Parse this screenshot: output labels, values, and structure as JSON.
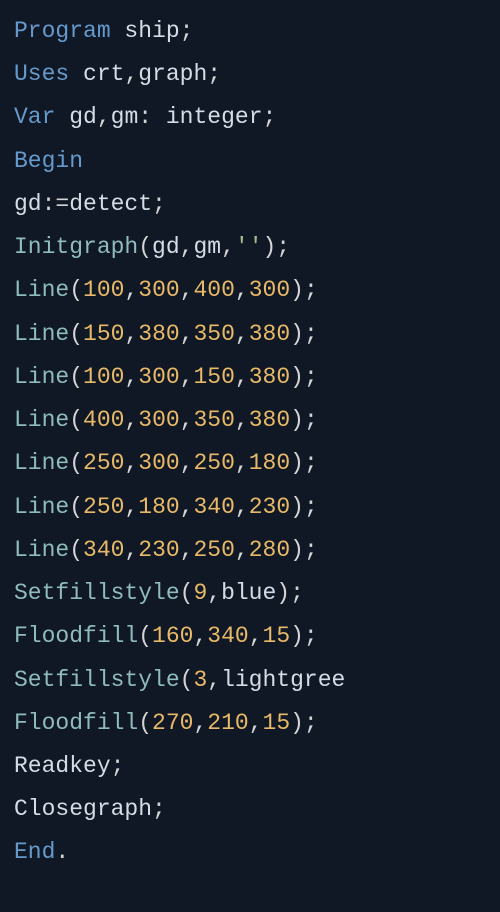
{
  "lines": [
    {
      "tokens": [
        {
          "cls": "kw",
          "text": "Program"
        },
        {
          "cls": "ident",
          "text": " ship"
        },
        {
          "cls": "punc",
          "text": ";"
        }
      ]
    },
    {
      "tokens": [
        {
          "cls": "kw",
          "text": "Uses"
        },
        {
          "cls": "ident",
          "text": " crt"
        },
        {
          "cls": "punc",
          "text": ","
        },
        {
          "cls": "ident",
          "text": "graph"
        },
        {
          "cls": "punc",
          "text": ";"
        }
      ]
    },
    {
      "tokens": [
        {
          "cls": "kw",
          "text": "Var"
        },
        {
          "cls": "ident",
          "text": " gd"
        },
        {
          "cls": "punc",
          "text": ","
        },
        {
          "cls": "ident",
          "text": "gm"
        },
        {
          "cls": "punc",
          "text": ": "
        },
        {
          "cls": "type",
          "text": "integer"
        },
        {
          "cls": "punc",
          "text": ";"
        }
      ]
    },
    {
      "tokens": [
        {
          "cls": "kw",
          "text": "Begin"
        }
      ]
    },
    {
      "tokens": [
        {
          "cls": "ident",
          "text": "gd"
        },
        {
          "cls": "punc",
          "text": ":="
        },
        {
          "cls": "ident",
          "text": "detect"
        },
        {
          "cls": "punc",
          "text": ";"
        }
      ]
    },
    {
      "tokens": [
        {
          "cls": "func",
          "text": "Initgraph"
        },
        {
          "cls": "punc",
          "text": "("
        },
        {
          "cls": "ident",
          "text": "gd"
        },
        {
          "cls": "punc",
          "text": ","
        },
        {
          "cls": "ident",
          "text": "gm"
        },
        {
          "cls": "punc",
          "text": ","
        },
        {
          "cls": "str",
          "text": "''"
        },
        {
          "cls": "punc",
          "text": ");"
        }
      ]
    },
    {
      "tokens": [
        {
          "cls": "func",
          "text": "Line"
        },
        {
          "cls": "punc",
          "text": "("
        },
        {
          "cls": "num",
          "text": "100"
        },
        {
          "cls": "punc",
          "text": ","
        },
        {
          "cls": "num",
          "text": "300"
        },
        {
          "cls": "punc",
          "text": ","
        },
        {
          "cls": "num",
          "text": "400"
        },
        {
          "cls": "punc",
          "text": ","
        },
        {
          "cls": "num",
          "text": "300"
        },
        {
          "cls": "punc",
          "text": ");"
        }
      ]
    },
    {
      "tokens": [
        {
          "cls": "func",
          "text": "Line"
        },
        {
          "cls": "punc",
          "text": "("
        },
        {
          "cls": "num",
          "text": "150"
        },
        {
          "cls": "punc",
          "text": ","
        },
        {
          "cls": "num",
          "text": "380"
        },
        {
          "cls": "punc",
          "text": ","
        },
        {
          "cls": "num",
          "text": "350"
        },
        {
          "cls": "punc",
          "text": ","
        },
        {
          "cls": "num",
          "text": "380"
        },
        {
          "cls": "punc",
          "text": ");"
        }
      ]
    },
    {
      "tokens": [
        {
          "cls": "func",
          "text": "Line"
        },
        {
          "cls": "punc",
          "text": "("
        },
        {
          "cls": "num",
          "text": "100"
        },
        {
          "cls": "punc",
          "text": ","
        },
        {
          "cls": "num",
          "text": "300"
        },
        {
          "cls": "punc",
          "text": ","
        },
        {
          "cls": "num",
          "text": "150"
        },
        {
          "cls": "punc",
          "text": ","
        },
        {
          "cls": "num",
          "text": "380"
        },
        {
          "cls": "punc",
          "text": ");"
        }
      ]
    },
    {
      "tokens": [
        {
          "cls": "func",
          "text": "Line"
        },
        {
          "cls": "punc",
          "text": "("
        },
        {
          "cls": "num",
          "text": "400"
        },
        {
          "cls": "punc",
          "text": ","
        },
        {
          "cls": "num",
          "text": "300"
        },
        {
          "cls": "punc",
          "text": ","
        },
        {
          "cls": "num",
          "text": "350"
        },
        {
          "cls": "punc",
          "text": ","
        },
        {
          "cls": "num",
          "text": "380"
        },
        {
          "cls": "punc",
          "text": ");"
        }
      ]
    },
    {
      "tokens": [
        {
          "cls": "func",
          "text": "Line"
        },
        {
          "cls": "punc",
          "text": "("
        },
        {
          "cls": "num",
          "text": "250"
        },
        {
          "cls": "punc",
          "text": ","
        },
        {
          "cls": "num",
          "text": "300"
        },
        {
          "cls": "punc",
          "text": ","
        },
        {
          "cls": "num",
          "text": "250"
        },
        {
          "cls": "punc",
          "text": ","
        },
        {
          "cls": "num",
          "text": "180"
        },
        {
          "cls": "punc",
          "text": ");"
        }
      ]
    },
    {
      "tokens": [
        {
          "cls": "func",
          "text": "Line"
        },
        {
          "cls": "punc",
          "text": "("
        },
        {
          "cls": "num",
          "text": "250"
        },
        {
          "cls": "punc",
          "text": ","
        },
        {
          "cls": "num",
          "text": "180"
        },
        {
          "cls": "punc",
          "text": ","
        },
        {
          "cls": "num",
          "text": "340"
        },
        {
          "cls": "punc",
          "text": ","
        },
        {
          "cls": "num",
          "text": "230"
        },
        {
          "cls": "punc",
          "text": ");"
        }
      ]
    },
    {
      "tokens": [
        {
          "cls": "func",
          "text": "Line"
        },
        {
          "cls": "punc",
          "text": "("
        },
        {
          "cls": "num",
          "text": "340"
        },
        {
          "cls": "punc",
          "text": ","
        },
        {
          "cls": "num",
          "text": "230"
        },
        {
          "cls": "punc",
          "text": ","
        },
        {
          "cls": "num",
          "text": "250"
        },
        {
          "cls": "punc",
          "text": ","
        },
        {
          "cls": "num",
          "text": "280"
        },
        {
          "cls": "punc",
          "text": ");"
        }
      ]
    },
    {
      "tokens": [
        {
          "cls": "func",
          "text": "Setfillstyle"
        },
        {
          "cls": "punc",
          "text": "("
        },
        {
          "cls": "num",
          "text": "9"
        },
        {
          "cls": "punc",
          "text": ","
        },
        {
          "cls": "const",
          "text": "blue"
        },
        {
          "cls": "punc",
          "text": ");"
        }
      ]
    },
    {
      "tokens": [
        {
          "cls": "func",
          "text": "Floodfill"
        },
        {
          "cls": "punc",
          "text": "("
        },
        {
          "cls": "num",
          "text": "160"
        },
        {
          "cls": "punc",
          "text": ","
        },
        {
          "cls": "num",
          "text": "340"
        },
        {
          "cls": "punc",
          "text": ","
        },
        {
          "cls": "num",
          "text": "15"
        },
        {
          "cls": "punc",
          "text": ");"
        }
      ]
    },
    {
      "tokens": [
        {
          "cls": "func",
          "text": "Setfillstyle"
        },
        {
          "cls": "punc",
          "text": "("
        },
        {
          "cls": "num",
          "text": "3"
        },
        {
          "cls": "punc",
          "text": ","
        },
        {
          "cls": "const",
          "text": "lightgree"
        }
      ]
    },
    {
      "tokens": [
        {
          "cls": "func",
          "text": "Floodfill"
        },
        {
          "cls": "punc",
          "text": "("
        },
        {
          "cls": "num",
          "text": "270"
        },
        {
          "cls": "punc",
          "text": ","
        },
        {
          "cls": "num",
          "text": "210"
        },
        {
          "cls": "punc",
          "text": ","
        },
        {
          "cls": "num",
          "text": "15"
        },
        {
          "cls": "punc",
          "text": ");"
        }
      ]
    },
    {
      "tokens": [
        {
          "cls": "ident",
          "text": "Readkey"
        },
        {
          "cls": "punc",
          "text": ";"
        }
      ]
    },
    {
      "tokens": [
        {
          "cls": "ident",
          "text": "Closegraph"
        },
        {
          "cls": "punc",
          "text": ";"
        }
      ]
    },
    {
      "tokens": [
        {
          "cls": "kw",
          "text": "End"
        },
        {
          "cls": "punc",
          "text": "."
        }
      ]
    }
  ]
}
